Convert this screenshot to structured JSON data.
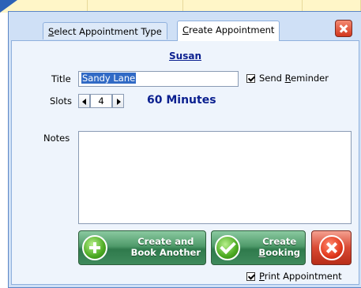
{
  "tabs": [
    {
      "label_pre": "",
      "label_ul": "S",
      "label_post": "elect Appointment Type"
    },
    {
      "label_pre": "",
      "label_ul": "C",
      "label_post": "reate Appointment"
    }
  ],
  "client_name": "Susan",
  "form": {
    "title_label": "Title",
    "title_value": "Sandy Lane",
    "send_reminder": {
      "pre": "Send ",
      "ul": "R",
      "post": "eminder",
      "checked": true
    },
    "slots_label": "Slots",
    "slots_value": "4",
    "duration_text": "60 Minutes",
    "notes_label": "Notes",
    "notes_value": ""
  },
  "buttons": {
    "create_another": {
      "line1": "Create and",
      "line2": "Book Another"
    },
    "create_booking": {
      "line1": "Create",
      "line2_ul": "B",
      "line2_post": "ooking"
    }
  },
  "print_appointment": {
    "ul": "P",
    "post": "rint Appointment",
    "checked": true
  },
  "colors": {
    "accent": "#0a1f8f",
    "panel": "#eef4fc",
    "frame": "#cfe0f6"
  }
}
